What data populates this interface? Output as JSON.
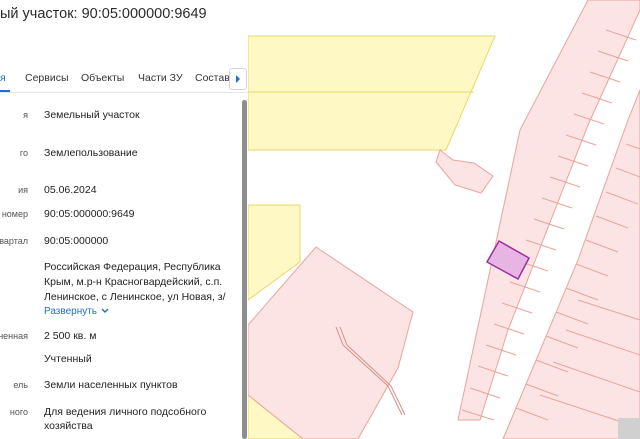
{
  "header": {
    "title": "ый участок: 90:05:000000:9649"
  },
  "tabs": [
    {
      "label": "я"
    },
    {
      "label": "Сервисы"
    },
    {
      "label": "Объекты"
    },
    {
      "label": "Части ЗУ"
    },
    {
      "label": "Состав"
    }
  ],
  "rows": [
    {
      "label": "я",
      "value": "Земельный участок"
    },
    {
      "label": "го",
      "value": "Землепользование"
    },
    {
      "label": "ия",
      "value": "05.06.2024"
    },
    {
      "label": "номер",
      "value": "90:05:000000:9649"
    },
    {
      "label": "квартал",
      "value": "90:05:000000"
    },
    {
      "label": "",
      "value": "Российская Федерация, Республика Крым, м.р-н Красногвардейский, с.п. Ленинское, с Ленинское, ул Новая, з/"
    },
    {
      "label": "ненная",
      "value": "2 500 кв. м"
    },
    {
      "label": "",
      "value": "Учтенный"
    },
    {
      "label": "ель",
      "value": "Земли населенных пунктов"
    },
    {
      "label": "ного",
      "value": "Для ведения личного подсобного хозяйства"
    }
  ],
  "address_expand": "Развернуть",
  "icons": {
    "tab_next": "chevron-right-icon",
    "expand": "chevron-down-icon"
  },
  "colors": {
    "accent": "#1f6fd1",
    "parcel_fill": "#fde4e4",
    "parcel_stroke": "#e8a49a",
    "zone_fill": "#fdf8c4",
    "selected_fill": "#e7b4e3",
    "selected_stroke": "#9b2f9d"
  }
}
